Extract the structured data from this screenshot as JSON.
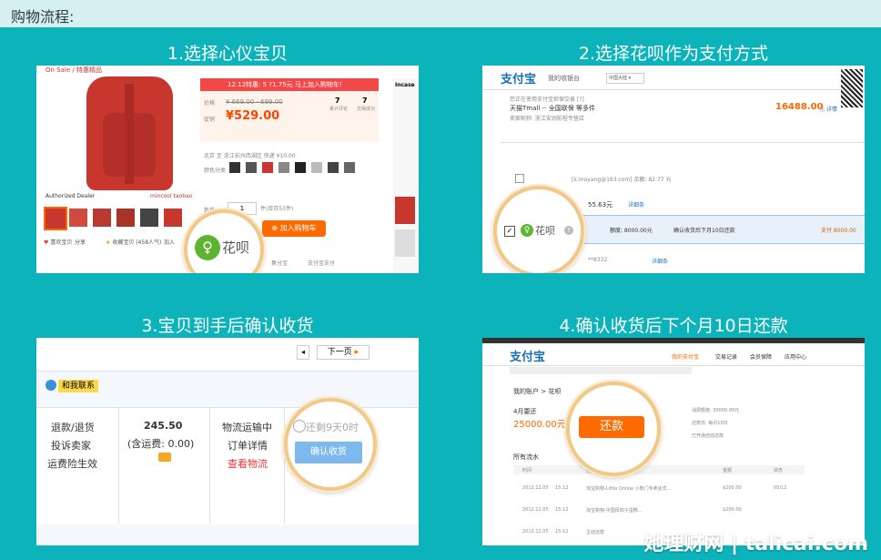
{
  "header": {
    "title": "购物流程:"
  },
  "steps": [
    {
      "title": "1.选择心仪宝贝"
    },
    {
      "title": "2.选择花呗作为支付方式"
    },
    {
      "title": "3.宝贝到手后确认收货"
    },
    {
      "title": "4.确认收货后下个月10日还款"
    }
  ],
  "p1": {
    "sale": "On Sale / 特惠精品",
    "promo": "12.12特惠: 5 ?1.75元  马上加入购物车!",
    "price_label": "价格",
    "price_old": "¥ 669.00 - 699.00",
    "promo_label": "促销",
    "price_new": "¥529.00",
    "count_a": "7",
    "count_a_lbl": "累计评论",
    "count_b": "7",
    "count_b_lbl": "交易成功",
    "ship": "北京 至 浙江杭州西湖区  快递 ¥10.00",
    "dealer": "Authorized Dealer",
    "brand": "mincool taobao",
    "color_label": "颜色分类",
    "qty_label": "数量",
    "qty": "1",
    "stock": "件(库存53件)",
    "add_cart": "加入购物车",
    "huabei": "花呗",
    "links": [
      "喜欢宝贝",
      "分享",
      "收藏宝贝 (458人气)",
      "加入"
    ],
    "bottom": [
      "集分宝",
      "支付宝支付"
    ],
    "sidebar_title": "Incase"
  },
  "p2": {
    "logo": "支付宝",
    "cashier": "我的收银台",
    "region": "中国大陆",
    "order_line": "您正在使用支付宝担保交易 [?]",
    "shop": "天猫Tmall -- 全国联保 等多件",
    "seller": "卖家昵称: 浙江安润前程专营店",
    "amount": "16488.00",
    "amount_unit": "元",
    "detail": "详情",
    "account": "[k.moyang@163.com] 余额: 82.77 元",
    "row2_amt": "55.63元",
    "row2_link": "详细条",
    "huabei": "花呗",
    "credit": "额度: 8000.00元",
    "confirm_next": "确认收货后下月10日还款",
    "pay": "支付 8000.00",
    "row4": "**8332",
    "row4_link": "详细条"
  },
  "p3": {
    "next": "下一页",
    "contact": "和我联系",
    "left": [
      "退款/退货",
      "投诉卖家",
      "运费险生效"
    ],
    "amount": "245.50",
    "freight": "(含运费: 0.00)",
    "status": [
      "物流运输中",
      "订单详情",
      "查看物流"
    ],
    "remain": "还剩9天0时",
    "confirm": "确认收货"
  },
  "p4": {
    "logo": "支付宝",
    "my_alipay": "我的支付宝",
    "nav": [
      "交易记录",
      "会员保障",
      "应用中心"
    ],
    "account": "我的账户 > 花呗",
    "due_label": "4月要还",
    "due": "25000.00元",
    "repay": "还款",
    "limit": "消费额度: 30000.00元",
    "date": "还款日: 每月10日",
    "overdue": "已开通自动还款",
    "flow": "所有流水",
    "cols": [
      "时间",
      "名称",
      "金额",
      "状态"
    ],
    "rows": [
      [
        "2012.12.05",
        "15:12",
        "淘宝购物-Little Online 小熊门专卖店式…",
        "$200.00",
        "05/12"
      ],
      [
        "2012.12.05",
        "15:12",
        "淘宝购物-中国风四子蛋糕…",
        "$200.00",
        ""
      ],
      [
        "2012.12.05",
        "15:12",
        "主动还款",
        "",
        ""
      ]
    ]
  },
  "watermark": "她理财网 | talicai.com",
  "colors": {
    "bg": "#0cb3bb",
    "accent": "#ff6a00",
    "huabei_green": "#5cb531"
  }
}
